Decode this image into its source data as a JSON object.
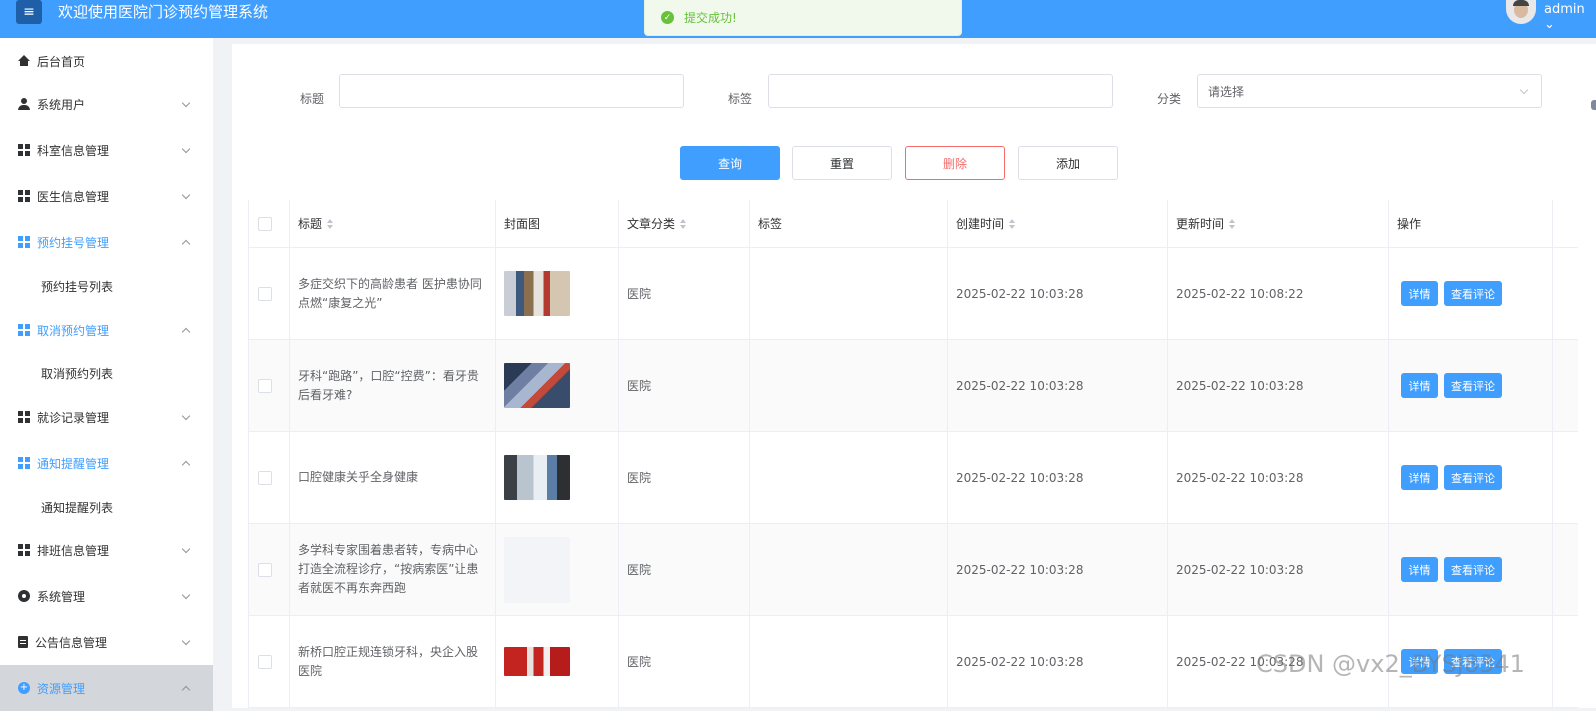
{
  "header": {
    "title": "欢迎使用医院门诊预约管理系统",
    "toast": "提交成功!",
    "user": "admin ⌄"
  },
  "sidebar": {
    "items": [
      {
        "label": "后台首页"
      },
      {
        "label": "系统用户"
      },
      {
        "label": "科室信息管理"
      },
      {
        "label": "医生信息管理"
      },
      {
        "label": "预约挂号管理"
      },
      {
        "label": "预约挂号列表"
      },
      {
        "label": "取消预约管理"
      },
      {
        "label": "取消预约列表"
      },
      {
        "label": "就诊记录管理"
      },
      {
        "label": "通知提醒管理"
      },
      {
        "label": "通知提醒列表"
      },
      {
        "label": "排班信息管理"
      },
      {
        "label": "系统管理"
      },
      {
        "label": "公告信息管理"
      },
      {
        "label": "资源管理"
      }
    ]
  },
  "filters": {
    "title_label": "标题",
    "tag_label": "标签",
    "category_label": "分类",
    "category_placeholder": "请选择"
  },
  "actions": {
    "query": "查询",
    "reset": "重置",
    "delete": "删除",
    "add": "添加"
  },
  "table": {
    "headers": [
      "标题",
      "封面图",
      "文章分类",
      "标签",
      "创建时间",
      "更新时间",
      "操作"
    ],
    "rows": [
      {
        "title": "多症交织下的高龄患者 医护患协同点燃“康复之光”",
        "category": "医院",
        "tag": "",
        "created": "2025-02-22 10:03:28",
        "updated": "2025-02-22 10:08:22"
      },
      {
        "title": "牙科“跑路”，口腔“控费”：看牙贵后看牙难?",
        "category": "医院",
        "tag": "",
        "created": "2025-02-22 10:03:28",
        "updated": "2025-02-22 10:03:28"
      },
      {
        "title": "口腔健康关乎全身健康",
        "category": "医院",
        "tag": "",
        "created": "2025-02-22 10:03:28",
        "updated": "2025-02-22 10:03:28"
      },
      {
        "title": "多学科专家围着患者转，专病中心打造全流程诊疗，“按病索医”让患者就医不再东奔西跑",
        "category": "医院",
        "tag": "",
        "created": "2025-02-22 10:03:28",
        "updated": "2025-02-22 10:03:28"
      },
      {
        "title": "新桥口腔正规连锁牙科，央企入股医院",
        "category": "医院",
        "tag": "",
        "created": "2025-02-22 10:03:28",
        "updated": "2025-02-22 10:03:28"
      }
    ],
    "detail_label": "详情",
    "comments_label": "查看评论"
  },
  "watermark": "CSDN @vx2_BYSJ8341",
  "colors": {
    "primary": "#409eff",
    "danger": "#f56c6c",
    "success": "#67c23a"
  }
}
